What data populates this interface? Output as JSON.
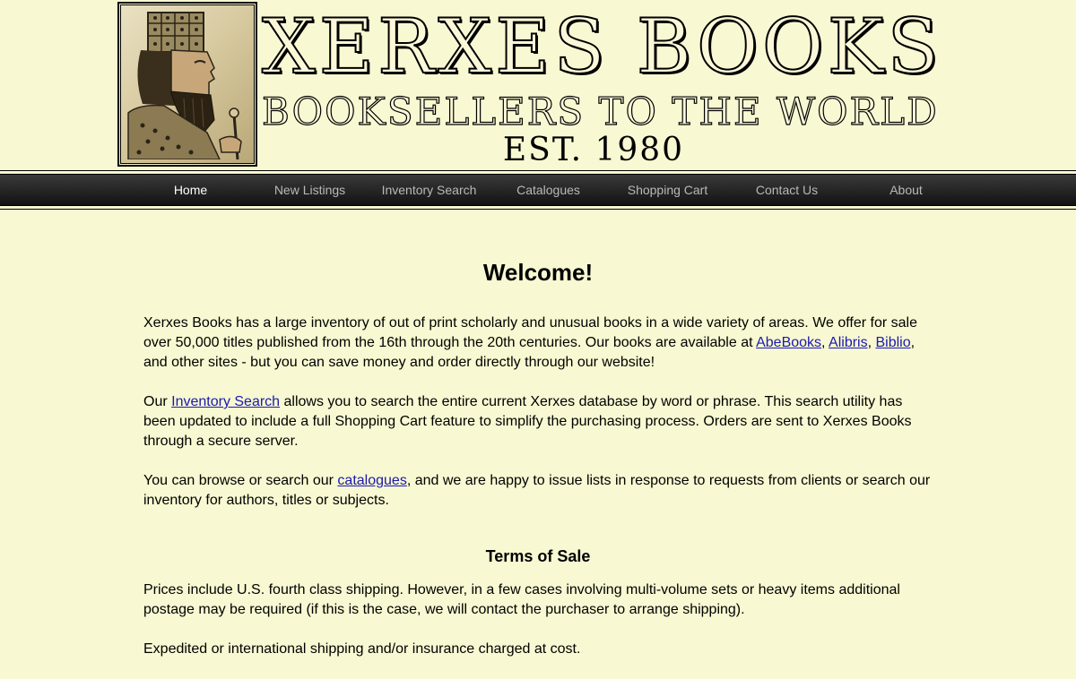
{
  "header": {
    "title": "XERXES BOOKS",
    "tagline": "BOOKSELLERS TO THE WORLD",
    "established": "EST. 1980"
  },
  "nav": {
    "items": [
      {
        "label": "Home",
        "active": true
      },
      {
        "label": "New Listings",
        "active": false
      },
      {
        "label": "Inventory Search",
        "active": false
      },
      {
        "label": "Catalogues",
        "active": false
      },
      {
        "label": "Shopping Cart",
        "active": false
      },
      {
        "label": "Contact Us",
        "active": false
      },
      {
        "label": "About",
        "active": false
      }
    ]
  },
  "welcome": {
    "heading": "Welcome!",
    "p1": {
      "text_a": "Xerxes Books has a large inventory of out of print scholarly and unusual books in a wide variety of areas. We offer for sale over 50,000 titles published from the 16th through the 20th centuries. Our books are available at ",
      "link_abebooks": "AbeBooks",
      "sep1": ", ",
      "link_alibris": "Alibris",
      "sep2": ", ",
      "link_biblio": "Biblio",
      "text_b": ", and other sites - but you can save money and order directly through our website!"
    },
    "p2": {
      "text_a": "Our ",
      "link_inventory": "Inventory Search",
      "text_b": " allows you to search the entire current Xerxes database by word or phrase. This search utility has been updated to include a full Shopping Cart feature to simplify the purchasing process. Orders are sent to Xerxes Books through a secure server."
    },
    "p3": {
      "text_a": "You can browse or search our ",
      "link_catalogues": "catalogues",
      "text_b": ", and we are happy to issue lists in response to requests from clients or search our inventory for authors, titles or subjects."
    }
  },
  "terms": {
    "heading": "Terms of Sale",
    "p1": "Prices include U.S. fourth class shipping. However, in a few cases involving multi-volume sets or heavy items additional postage may be required (if this is the case, we will contact the purchaser to arrange shipping).",
    "p2": "Expedited or international shipping and/or insurance charged at cost."
  },
  "colors": {
    "background": "#f8f8d2",
    "nav_bar": "#262626",
    "nav_text": "#b9b9b9",
    "nav_active_text": "#ffffff",
    "link": "#1a1aae"
  },
  "icons": {
    "logo": "xerxes-portrait-icon"
  }
}
